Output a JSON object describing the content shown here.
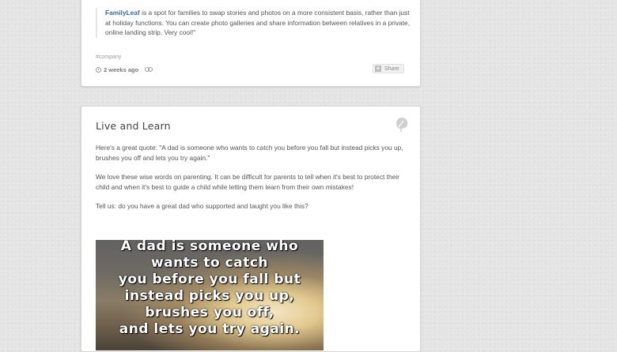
{
  "post1": {
    "quote_link": "FamilyLeaf",
    "quote_text": " is a spot for families to swap stories and photos on a more consistent basis, rather than just at holiday functions. You can create photo galleries and share information between relatives in a private, online landing strip. Very cool!\"",
    "tag": "#company",
    "timestamp": "2 weeks ago",
    "share_label": "Share"
  },
  "post2": {
    "title": "Live and Learn",
    "paragraphs": [
      "Here's a great quote: \"A dad is someone who wants to catch you before you fall but instead picks you up, brushes you off and lets you try again.\"",
      "We love these wise words on parenting. It can be difficult for parents to tell when it's best to protect their child and when it's best to guide a child while letting them learn from their own mistakes!",
      "Tell us: do you have a great dad who supported and taught you like this?"
    ],
    "image_lines": [
      "A dad is someone who",
      "wants to catch",
      "you before you fall but",
      "instead picks you up,",
      "brushes you off,",
      "and lets you try again."
    ]
  }
}
